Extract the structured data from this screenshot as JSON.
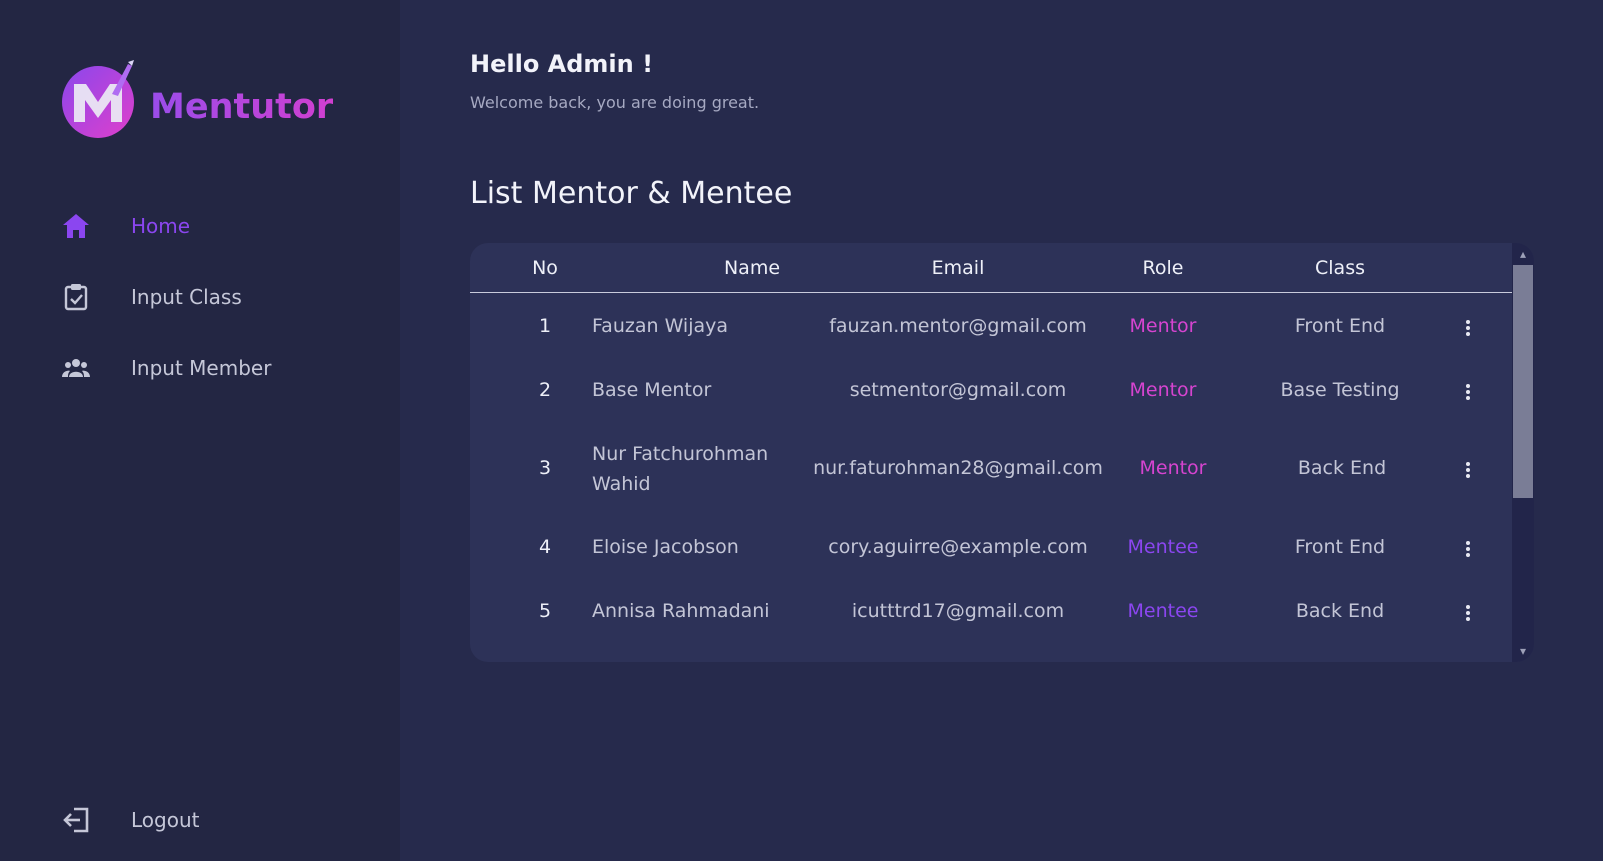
{
  "brand": {
    "name": "Mentutor",
    "logo_letter": "M",
    "gradient_start": "#9a4dea",
    "gradient_end": "#d13fd0"
  },
  "sidebar": {
    "items": [
      {
        "label": "Home",
        "icon": "home-icon",
        "active": true
      },
      {
        "label": "Input Class",
        "icon": "clipboard-check-icon",
        "active": false
      },
      {
        "label": "Input Member",
        "icon": "users-icon",
        "active": false
      }
    ],
    "logout": {
      "label": "Logout",
      "icon": "logout-icon"
    }
  },
  "header": {
    "greeting": "Hello Admin !",
    "subtitle": "Welcome back, you are doing great."
  },
  "section": {
    "title": "List Mentor & Mentee"
  },
  "table": {
    "columns": [
      "No",
      "Name",
      "Email",
      "Role",
      "Class"
    ],
    "rows": [
      {
        "no": "1",
        "name": "Fauzan Wijaya",
        "email": "fauzan.mentor@gmail.com",
        "role": "Mentor",
        "class": "Front End"
      },
      {
        "no": "2",
        "name": "Base Mentor",
        "email": "setmentor@gmail.com",
        "role": "Mentor",
        "class": "Base Testing"
      },
      {
        "no": "3",
        "name": "Nur Fatchurohman Wahid",
        "email": "nur.faturohman28@gmail.com",
        "role": "Mentor",
        "class": "Back End"
      },
      {
        "no": "4",
        "name": "Eloise Jacobson",
        "email": "cory.aguirre@example.com",
        "role": "Mentee",
        "class": "Front End"
      },
      {
        "no": "5",
        "name": "Annisa Rahmadani",
        "email": "icutttrd17@gmail.com",
        "role": "Mentee",
        "class": "Back End"
      }
    ]
  },
  "colors": {
    "background": "#262a4c",
    "sidebar": "#232643",
    "card": "#2d3258",
    "accent_purple": "#8b46f0",
    "accent_pink": "#d644d0"
  }
}
